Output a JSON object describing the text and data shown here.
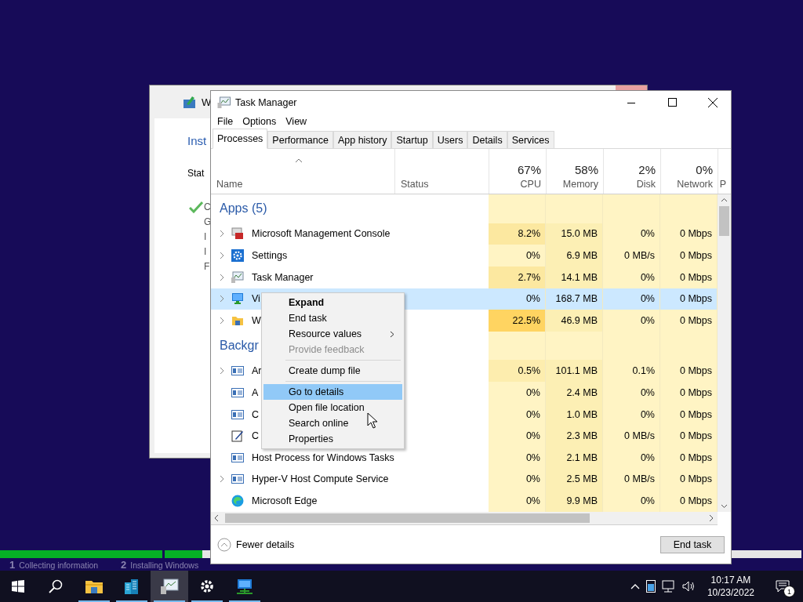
{
  "setup_window": {
    "title": "W",
    "heading": "Inst",
    "status_label": "Stat",
    "steps": [
      {
        "text": "C",
        "done": true
      },
      {
        "text": "G",
        "done": false
      },
      {
        "text": "I",
        "done": false
      },
      {
        "text": "I",
        "done": false
      },
      {
        "text": "F",
        "done": false
      }
    ]
  },
  "task_manager": {
    "title": "Task Manager",
    "menu": [
      "File",
      "Options",
      "View"
    ],
    "tabs": [
      {
        "label": "Processes",
        "selected": true
      },
      {
        "label": "Performance",
        "selected": false
      },
      {
        "label": "App history",
        "selected": false
      },
      {
        "label": "Startup",
        "selected": false
      },
      {
        "label": "Users",
        "selected": false
      },
      {
        "label": "Details",
        "selected": false
      },
      {
        "label": "Services",
        "selected": false
      }
    ],
    "columns": [
      {
        "label": "Name",
        "sorted": true
      },
      {
        "label": "Status",
        "sorted": false
      },
      {
        "label": "CPU",
        "usage": "67%",
        "sorted": false
      },
      {
        "label": "Memory",
        "usage": "58%",
        "sorted": false
      },
      {
        "label": "Disk",
        "usage": "2%",
        "sorted": false
      },
      {
        "label": "Network",
        "usage": "0%",
        "sorted": false
      },
      {
        "label": "P",
        "sorted": false
      }
    ],
    "groups": [
      {
        "title": "Apps (5)",
        "rows": [
          {
            "name": "Microsoft Management Console",
            "expandable": true,
            "selected": false,
            "cpu": "8.2%",
            "memory": "15.0 MB",
            "disk": "0%",
            "network": "0 Mbps"
          },
          {
            "name": "Settings",
            "expandable": true,
            "selected": false,
            "cpu": "0%",
            "memory": "6.9 MB",
            "disk": "0 MB/s",
            "network": "0 Mbps"
          },
          {
            "name": "Task Manager",
            "expandable": true,
            "selected": false,
            "cpu": "2.7%",
            "memory": "14.1 MB",
            "disk": "0%",
            "network": "0 Mbps"
          },
          {
            "name": "Vi",
            "expandable": true,
            "selected": true,
            "cpu": "0%",
            "memory": "168.7 MB",
            "disk": "0%",
            "network": "0 Mbps"
          },
          {
            "name": "W",
            "expandable": true,
            "selected": false,
            "cpu": "22.5%",
            "memory": "46.9 MB",
            "disk": "0%",
            "network": "0 Mbps"
          }
        ]
      },
      {
        "title": "Backgr",
        "rows": [
          {
            "name": "Ar",
            "expandable": true,
            "selected": false,
            "cpu": "0.5%",
            "memory": "101.1 MB",
            "disk": "0.1%",
            "network": "0 Mbps"
          },
          {
            "name": "A",
            "expandable": false,
            "selected": false,
            "cpu": "0%",
            "memory": "2.4 MB",
            "disk": "0%",
            "network": "0 Mbps"
          },
          {
            "name": "C",
            "expandable": false,
            "selected": false,
            "cpu": "0%",
            "memory": "1.0 MB",
            "disk": "0%",
            "network": "0 Mbps"
          },
          {
            "name": "C",
            "expandable": false,
            "selected": false,
            "cpu": "0%",
            "memory": "2.3 MB",
            "disk": "0 MB/s",
            "network": "0 Mbps"
          },
          {
            "name": "Host Process for Windows Tasks",
            "expandable": false,
            "selected": false,
            "cpu": "0%",
            "memory": "2.1 MB",
            "disk": "0%",
            "network": "0 Mbps"
          },
          {
            "name": "Hyper-V Host Compute Service",
            "expandable": true,
            "selected": false,
            "cpu": "0%",
            "memory": "2.5 MB",
            "disk": "0 MB/s",
            "network": "0 Mbps"
          },
          {
            "name": "Microsoft Edge",
            "expandable": false,
            "selected": false,
            "cpu": "0%",
            "memory": "9.9 MB",
            "disk": "0%",
            "network": "0 Mbps"
          }
        ]
      }
    ],
    "fewer_details": "Fewer details",
    "end_task": "End task"
  },
  "context_menu": [
    {
      "kind": "item",
      "label": "Expand",
      "default": true,
      "disabled": false,
      "highlighted": false,
      "submenu": false
    },
    {
      "kind": "item",
      "label": "End task",
      "default": false,
      "disabled": false,
      "highlighted": false,
      "submenu": false
    },
    {
      "kind": "item",
      "label": "Resource values",
      "default": false,
      "disabled": false,
      "highlighted": false,
      "submenu": true
    },
    {
      "kind": "item",
      "label": "Provide feedback",
      "default": false,
      "disabled": true,
      "highlighted": false,
      "submenu": false
    },
    {
      "kind": "separator"
    },
    {
      "kind": "item",
      "label": "Create dump file",
      "default": false,
      "disabled": false,
      "highlighted": false,
      "submenu": false
    },
    {
      "kind": "separator"
    },
    {
      "kind": "item",
      "label": "Go to details",
      "default": false,
      "disabled": false,
      "highlighted": true,
      "submenu": false
    },
    {
      "kind": "item",
      "label": "Open file location",
      "default": false,
      "disabled": false,
      "highlighted": false,
      "submenu": false
    },
    {
      "kind": "item",
      "label": "Search online",
      "default": false,
      "disabled": false,
      "highlighted": false,
      "submenu": false
    },
    {
      "kind": "item",
      "label": "Properties",
      "default": false,
      "disabled": false,
      "highlighted": false,
      "submenu": false
    }
  ],
  "setup_progress": [
    {
      "level": 1
    },
    {
      "level": 0.059
    }
  ],
  "setup_stages": [
    {
      "number": "1",
      "label": "Collecting information"
    },
    {
      "number": "2",
      "label": "Installing Windows"
    }
  ],
  "taskbar": {
    "apps": [
      {
        "running": true
      },
      {
        "running": true
      },
      {
        "running": true,
        "selected": true
      },
      {
        "running": true,
        "selected": false
      },
      {
        "running": true,
        "selected": false
      }
    ],
    "time": "10:17 AM",
    "date": "10/23/2022",
    "notifications": "1"
  }
}
